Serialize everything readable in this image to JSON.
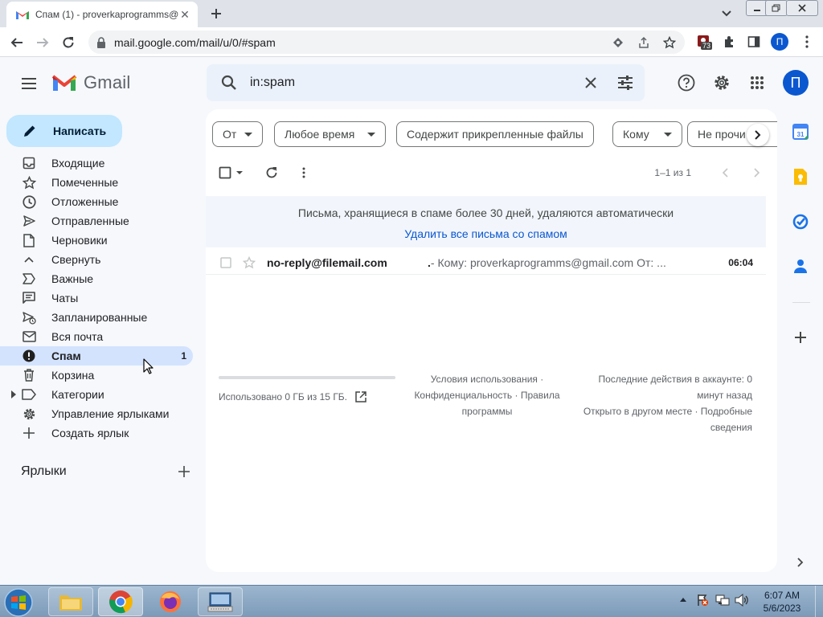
{
  "browser": {
    "tab_title": "Спам (1) - proverkaprogramms@",
    "url": "mail.google.com/mail/u/0/#spam",
    "profile_initial": "П",
    "extension_badge": "73"
  },
  "gmail": {
    "app_name": "Gmail",
    "search_query": "in:spam",
    "avatar_initial": "П",
    "compose_label": "Написать"
  },
  "sidebar": {
    "items": [
      {
        "label": "Входящие",
        "icon": "inbox-icon"
      },
      {
        "label": "Помеченные",
        "icon": "star-icon"
      },
      {
        "label": "Отложенные",
        "icon": "clock-icon"
      },
      {
        "label": "Отправленные",
        "icon": "send-icon"
      },
      {
        "label": "Черновики",
        "icon": "draft-icon"
      },
      {
        "label": "Свернуть",
        "icon": "chevron-up-icon"
      },
      {
        "label": "Важные",
        "icon": "important-icon"
      },
      {
        "label": "Чаты",
        "icon": "chat-icon"
      },
      {
        "label": "Запланированные",
        "icon": "scheduled-icon"
      },
      {
        "label": "Вся почта",
        "icon": "all-mail-icon"
      },
      {
        "label": "Спам",
        "icon": "spam-icon",
        "count": "1",
        "active": true
      },
      {
        "label": "Корзина",
        "icon": "trash-icon"
      },
      {
        "label": "Категории",
        "icon": "label-icon"
      },
      {
        "label": "Управление ярлыками",
        "icon": "gear-icon"
      },
      {
        "label": "Создать ярлык",
        "icon": "plus-icon"
      }
    ],
    "labels_heading": "Ярлыки"
  },
  "filters": {
    "from": "От",
    "any_time": "Любое время",
    "has_attachments": "Содержит прикрепленные файлы",
    "to": "Кому",
    "unread": "Не прочи"
  },
  "toolbar": {
    "pager": "1–1 из 1"
  },
  "banner": {
    "message": "Письма, хранящиеся в спаме более 30 дней, удаляются автоматически",
    "action": "Удалить все письма со спамом"
  },
  "emails": [
    {
      "sender": "no-reply@filemail.com",
      "subject": ".",
      "snippet": " - Кому: proverkaprogramms@gmail.com От: ...",
      "time": "06:04"
    }
  ],
  "footer": {
    "storage": "Использовано 0 ГБ из 15 ГБ.",
    "storage_fraction": 0,
    "terms": "Условия использования ·",
    "privacy": "Конфиденциальность · Правила",
    "program": "программы",
    "last_activity": "Последние действия в аккаунте: 0",
    "minutes_ago": "минут назад",
    "open_elsewhere": "Открыто в другом месте · Подробные",
    "details": "сведения"
  },
  "taskbar": {
    "time": "6:07 AM",
    "date": "5/6/2023"
  },
  "colors": {
    "accent": "#0b57d0",
    "compose_bg": "#c2e7ff",
    "active_nav": "#d3e3fd",
    "gmail_red": "#ea4335"
  }
}
